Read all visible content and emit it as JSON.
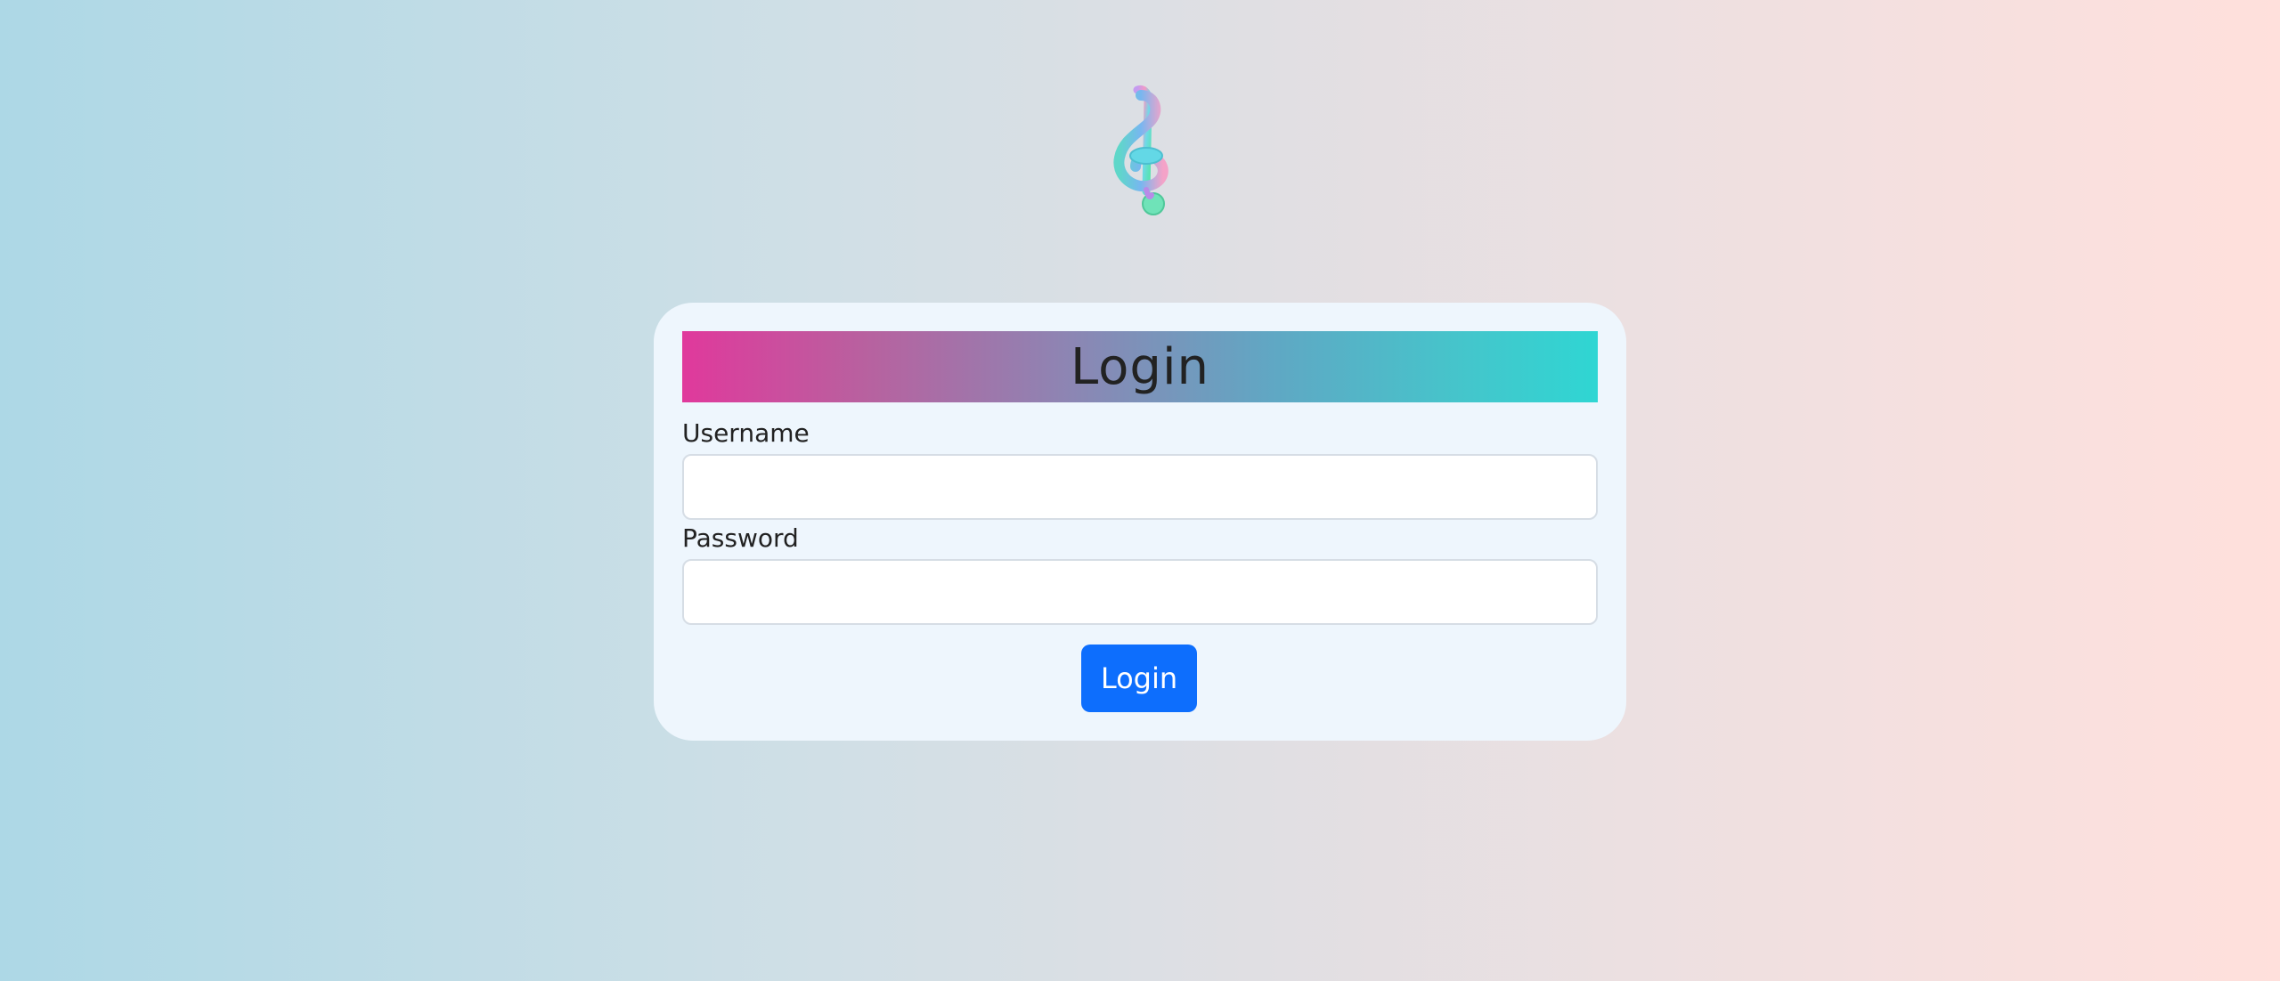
{
  "logo": {
    "icon": "treble-clef-icon"
  },
  "form": {
    "title": "Login",
    "username_label": "Username",
    "username_value": "",
    "password_label": "Password",
    "password_value": "",
    "submit_label": "Login"
  },
  "colors": {
    "primary_button": "#0d6efd",
    "header_gradient_start": "#e0399c",
    "header_gradient_end": "#2fd6d3",
    "card_background": "#eef6fd"
  }
}
